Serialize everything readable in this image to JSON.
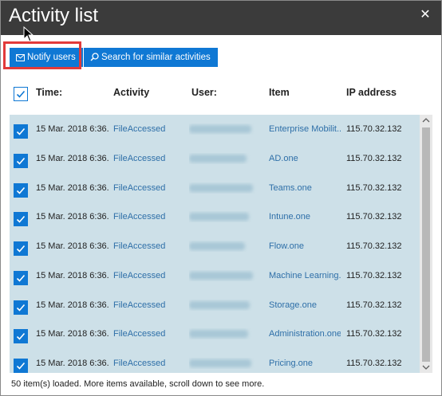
{
  "dialog": {
    "title": "Activity list",
    "close_glyph": "✕"
  },
  "toolbar": {
    "notify_label": "Notify users",
    "notify_icon": "mail-icon",
    "search_label": "Search for similar activities",
    "search_icon": "search-icon"
  },
  "columns": {
    "time": "Time:",
    "activity": "Activity",
    "user": "User:",
    "item": "Item",
    "ip": "IP address"
  },
  "rows": [
    {
      "time": "15 Mar. 2018 6:36...",
      "activity": "FileAccessed",
      "user": "",
      "item": "Enterprise Mobilit...",
      "ip": "115.70.32.132",
      "checked": true
    },
    {
      "time": "15 Mar. 2018 6:36...",
      "activity": "FileAccessed",
      "user": "",
      "item": "AD.one",
      "ip": "115.70.32.132",
      "checked": true
    },
    {
      "time": "15 Mar. 2018 6:36...",
      "activity": "FileAccessed",
      "user": "",
      "item": "Teams.one",
      "ip": "115.70.32.132",
      "checked": true
    },
    {
      "time": "15 Mar. 2018 6:36...",
      "activity": "FileAccessed",
      "user": "",
      "item": "Intune.one",
      "ip": "115.70.32.132",
      "checked": true
    },
    {
      "time": "15 Mar. 2018 6:36...",
      "activity": "FileAccessed",
      "user": "",
      "item": "Flow.one",
      "ip": "115.70.32.132",
      "checked": true
    },
    {
      "time": "15 Mar. 2018 6:36...",
      "activity": "FileAccessed",
      "user": "",
      "item": "Machine Learning...",
      "ip": "115.70.32.132",
      "checked": true
    },
    {
      "time": "15 Mar. 2018 6:36...",
      "activity": "FileAccessed",
      "user": "",
      "item": "Storage.one",
      "ip": "115.70.32.132",
      "checked": true
    },
    {
      "time": "15 Mar. 2018 6:36...",
      "activity": "FileAccessed",
      "user": "",
      "item": "Administration.one",
      "ip": "115.70.32.132",
      "checked": true
    },
    {
      "time": "15 Mar. 2018 6:36...",
      "activity": "FileAccessed",
      "user": "",
      "item": "Pricing.one",
      "ip": "115.70.32.132",
      "checked": true
    }
  ],
  "status": "50 item(s) loaded. More items available, scroll down to see more.",
  "colors": {
    "titlebar": "#3b3b3b",
    "accent": "#0f78d4",
    "selection": "#cde0e8",
    "link": "#2e6fa8",
    "highlight_box": "#e23a3a"
  }
}
